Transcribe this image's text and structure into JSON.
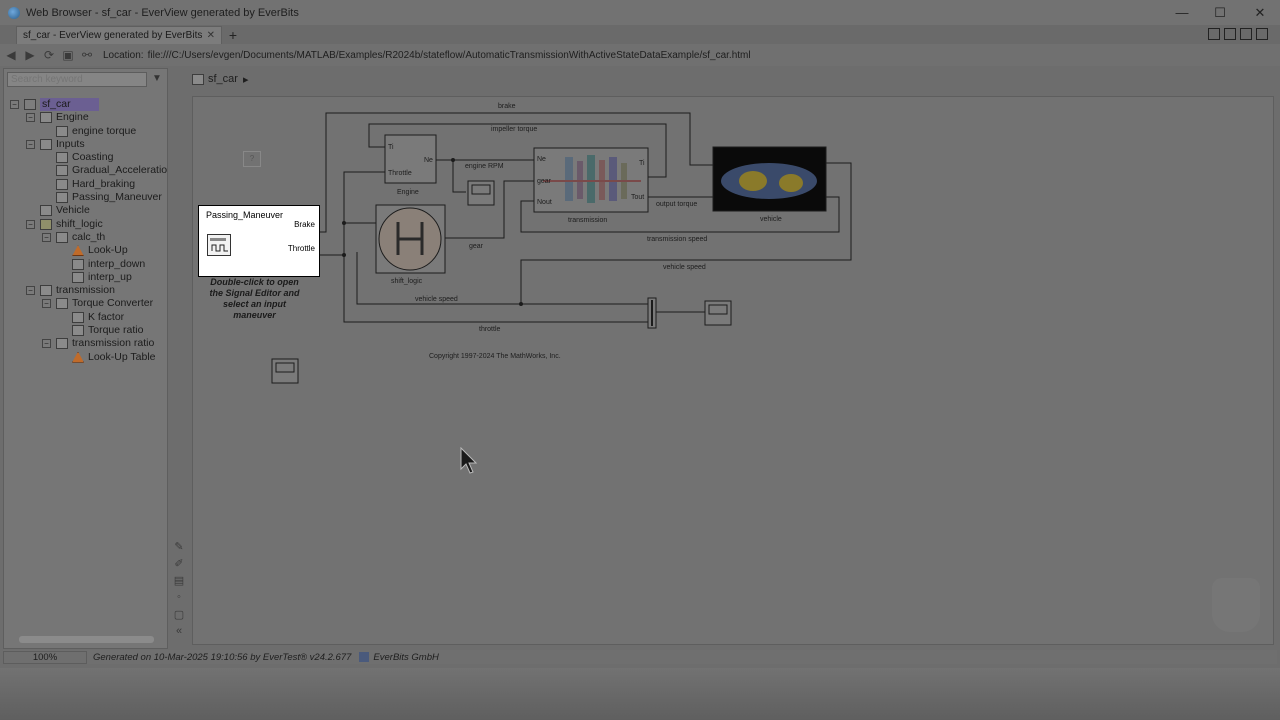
{
  "window": {
    "title": "Web Browser - sf_car - EverView generated by EverBits",
    "minimize": "—",
    "maximize": "☐",
    "close": "✕"
  },
  "tab": {
    "label": "sf_car - EverView generated by EverBits",
    "close": "✕",
    "new": "+"
  },
  "location": {
    "label": "Location:",
    "url": "file:///C:/Users/evgen/Documents/MATLAB/Examples/R2024b/stateflow/AutomaticTransmissionWithActiveStateDataExample/sf_car.html"
  },
  "sidebar": {
    "search_placeholder": "Search keyword",
    "tree": [
      {
        "label": "sf_car",
        "level": 0,
        "toggle": "−",
        "icon": "chart",
        "selected": true
      },
      {
        "label": "Engine",
        "level": 1,
        "toggle": "−",
        "icon": "block"
      },
      {
        "label": "engine torque",
        "level": 2,
        "toggle": "",
        "icon": "lookup"
      },
      {
        "label": "Inputs",
        "level": 1,
        "toggle": "−",
        "icon": "block"
      },
      {
        "label": "Coasting",
        "level": 2,
        "toggle": "",
        "icon": "block"
      },
      {
        "label": "Gradual_Acceleration",
        "level": 2,
        "toggle": "",
        "icon": "block"
      },
      {
        "label": "Hard_braking",
        "level": 2,
        "toggle": "",
        "icon": "block"
      },
      {
        "label": "Passing_Maneuver",
        "level": 2,
        "toggle": "",
        "icon": "block"
      },
      {
        "label": "Vehicle",
        "level": 1,
        "toggle": "",
        "icon": "block"
      },
      {
        "label": "shift_logic",
        "level": 1,
        "toggle": "−",
        "icon": "stateflow"
      },
      {
        "label": "calc_th",
        "level": 2,
        "toggle": "−",
        "icon": "block"
      },
      {
        "label": "Look-Up",
        "level": 3,
        "toggle": "",
        "icon": "fn"
      },
      {
        "label": "interp_down",
        "level": 3,
        "toggle": "",
        "icon": "lookup"
      },
      {
        "label": "interp_up",
        "level": 3,
        "toggle": "",
        "icon": "lookup"
      },
      {
        "label": "transmission",
        "level": 1,
        "toggle": "−",
        "icon": "block"
      },
      {
        "label": "Torque Converter",
        "level": 2,
        "toggle": "−",
        "icon": "block"
      },
      {
        "label": "K factor",
        "level": 3,
        "toggle": "",
        "icon": "lookup"
      },
      {
        "label": "Torque ratio",
        "level": 3,
        "toggle": "",
        "icon": "lookup"
      },
      {
        "label": "transmission ratio",
        "level": 2,
        "toggle": "−",
        "icon": "block"
      },
      {
        "label": "Look-Up Table",
        "level": 3,
        "toggle": "",
        "icon": "fn"
      }
    ]
  },
  "breadcrumb": {
    "model": "sf_car",
    "arrow": "▸"
  },
  "diagram": {
    "passing_block": {
      "name": "Passing_Maneuver",
      "port_brake": "Brake",
      "port_throttle": "Throttle"
    },
    "note": "Double-click to open the Signal Editor and select an input maneuver",
    "question": "?",
    "engine": {
      "label": "Engine",
      "in1": "Ti",
      "in2": "Throttle",
      "out": "Ne"
    },
    "shift_logic": {
      "label": "shift_logic"
    },
    "transmission": {
      "label": "transmission",
      "in1": "Ne",
      "in2": "gear",
      "in3": "Nout",
      "out1": "Ti",
      "out2": "Tout"
    },
    "vehicle": {
      "label": "vehicle"
    },
    "signals": {
      "brake": "brake",
      "impeller_torque": "impeller torque",
      "engine_rpm": "engine RPM",
      "gear": "gear",
      "output_torque": "output torque",
      "transmission_speed": "transmission speed",
      "vehicle_speed_top": "vehicle speed",
      "vehicle_speed_bottom": "vehicle speed",
      "throttle": "throttle"
    },
    "copyright": "Copyright 1997-2024 The MathWorks, Inc."
  },
  "status": {
    "zoom": "100%",
    "generated": "Generated on 10-Mar-2025 19:10:56 by EverTest® v24.2.677",
    "company": "EverBits GmbH"
  }
}
